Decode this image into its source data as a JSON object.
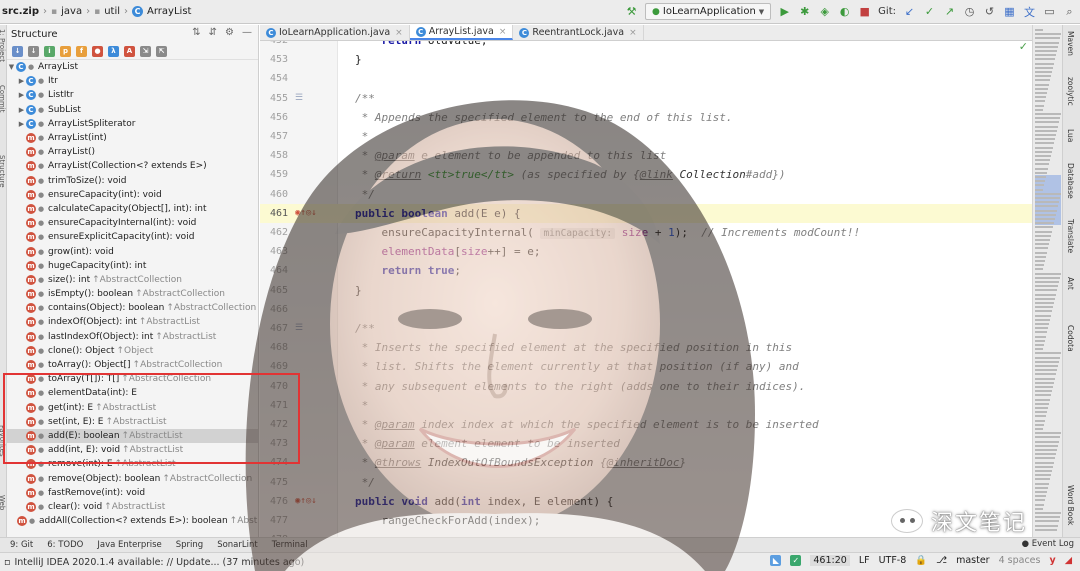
{
  "navbar": {
    "breadcrumbs": [
      "src.zip",
      "java",
      "util",
      "ArrayList"
    ],
    "run_config": "IoLearnApplication",
    "git_label": "Git:"
  },
  "structure": {
    "title": "Structure",
    "root": "ArrayList",
    "items": [
      {
        "icon": "c",
        "label": "Itr",
        "inherited": ""
      },
      {
        "icon": "c",
        "label": "ListItr",
        "inherited": ""
      },
      {
        "icon": "c",
        "label": "SubList",
        "inherited": ""
      },
      {
        "icon": "c",
        "label": "ArrayListSpliterator",
        "inherited": ""
      },
      {
        "icon": "m",
        "label": "ArrayList(int)",
        "inherited": ""
      },
      {
        "icon": "m",
        "label": "ArrayList()",
        "inherited": ""
      },
      {
        "icon": "m",
        "label": "ArrayList(Collection<? extends E>)",
        "inherited": ""
      },
      {
        "icon": "m",
        "label": "trimToSize(): void",
        "inherited": ""
      },
      {
        "icon": "m",
        "label": "ensureCapacity(int): void",
        "inherited": ""
      },
      {
        "icon": "m",
        "label": "calculateCapacity(Object[], int): int",
        "inherited": ""
      },
      {
        "icon": "m",
        "label": "ensureCapacityInternal(int): void",
        "inherited": ""
      },
      {
        "icon": "m",
        "label": "ensureExplicitCapacity(int): void",
        "inherited": ""
      },
      {
        "icon": "m",
        "label": "grow(int): void",
        "inherited": ""
      },
      {
        "icon": "m",
        "label": "hugeCapacity(int): int",
        "inherited": ""
      },
      {
        "icon": "m",
        "label": "size(): int",
        "inherited": "↑AbstractCollection"
      },
      {
        "icon": "m",
        "label": "isEmpty(): boolean",
        "inherited": "↑AbstractCollection"
      },
      {
        "icon": "m",
        "label": "contains(Object): boolean",
        "inherited": "↑AbstractCollection"
      },
      {
        "icon": "m",
        "label": "indexOf(Object): int",
        "inherited": "↑AbstractList"
      },
      {
        "icon": "m",
        "label": "lastIndexOf(Object): int",
        "inherited": "↑AbstractList"
      },
      {
        "icon": "m",
        "label": "clone(): Object",
        "inherited": "↑Object"
      },
      {
        "icon": "m",
        "label": "toArray(): Object[]",
        "inherited": "↑AbstractCollection"
      },
      {
        "icon": "m",
        "label": "toArray(T[]): T[]",
        "inherited": "↑AbstractCollection"
      },
      {
        "icon": "m",
        "label": "elementData(int): E",
        "inherited": ""
      },
      {
        "icon": "m",
        "label": "get(int): E",
        "inherited": "↑AbstractList"
      },
      {
        "icon": "m",
        "label": "set(int, E): E",
        "inherited": "↑AbstractList"
      },
      {
        "icon": "m",
        "label": "add(E): boolean",
        "inherited": "↑AbstractList"
      },
      {
        "icon": "m",
        "label": "add(int, E): void",
        "inherited": "↑AbstractList"
      },
      {
        "icon": "m",
        "label": "remove(int): E",
        "inherited": "↑AbstractList"
      },
      {
        "icon": "m",
        "label": "remove(Object): boolean",
        "inherited": "↑AbstractCollection"
      },
      {
        "icon": "m",
        "label": "fastRemove(int): void",
        "inherited": ""
      },
      {
        "icon": "m",
        "label": "clear(): void",
        "inherited": "↑AbstractList"
      },
      {
        "icon": "m",
        "label": "addAll(Collection<? extends E>): boolean",
        "inherited": "↑AbstractL"
      }
    ]
  },
  "tabs": [
    {
      "label": "IoLearnApplication.java",
      "active": false
    },
    {
      "label": "ArrayList.java",
      "active": true
    },
    {
      "label": "ReentrantLock.java",
      "active": false
    }
  ],
  "bottom_tools": [
    "9: Git",
    "6: TODO",
    "Java Enterprise",
    "Spring",
    "SonarLint",
    "Terminal"
  ],
  "event_log": "Event Log",
  "status": {
    "message": "IntelliJ IDEA 2020.1.4 available: // Update... (37 minutes ago)",
    "position": "461:20",
    "line_sep": "LF",
    "encoding": "UTF-8",
    "indent": "4 spaces",
    "branch": "master"
  },
  "right_tools": [
    "Maven",
    "zoolytic",
    "Lua",
    "Database",
    "Translate",
    "Ant",
    "Codota",
    "Word Book"
  ],
  "watermark": "深文笔记",
  "colors": {
    "accent": "#4a86e8",
    "highlight_box": "#e23434",
    "keyword": "#1a1aa6",
    "comment": "#808080"
  }
}
